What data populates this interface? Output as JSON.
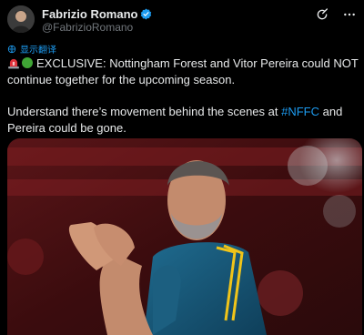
{
  "author": {
    "display_name": "Fabrizio Romano",
    "handle": "@FabrizioRomano",
    "verified": true
  },
  "header_actions": [
    {
      "name": "grok-icon"
    },
    {
      "name": "more-icon"
    }
  ],
  "translate_label": "显示翻译",
  "tweet": {
    "line1": "EXCLUSIVE: Nottingham Forest and Vitor Pereira could NOT continue together for the upcoming season.",
    "line2_before": "Understand there’s movement behind the scenes at ",
    "hashtag": "#NFFC",
    "line2_after": " and Pereira could be gone."
  },
  "colors": {
    "link": "#1d9bf0",
    "text": "#e7e9ea",
    "muted": "#71767b",
    "background": "#000000"
  },
  "media": {
    "description": "photo of coach applauding in stadium"
  }
}
